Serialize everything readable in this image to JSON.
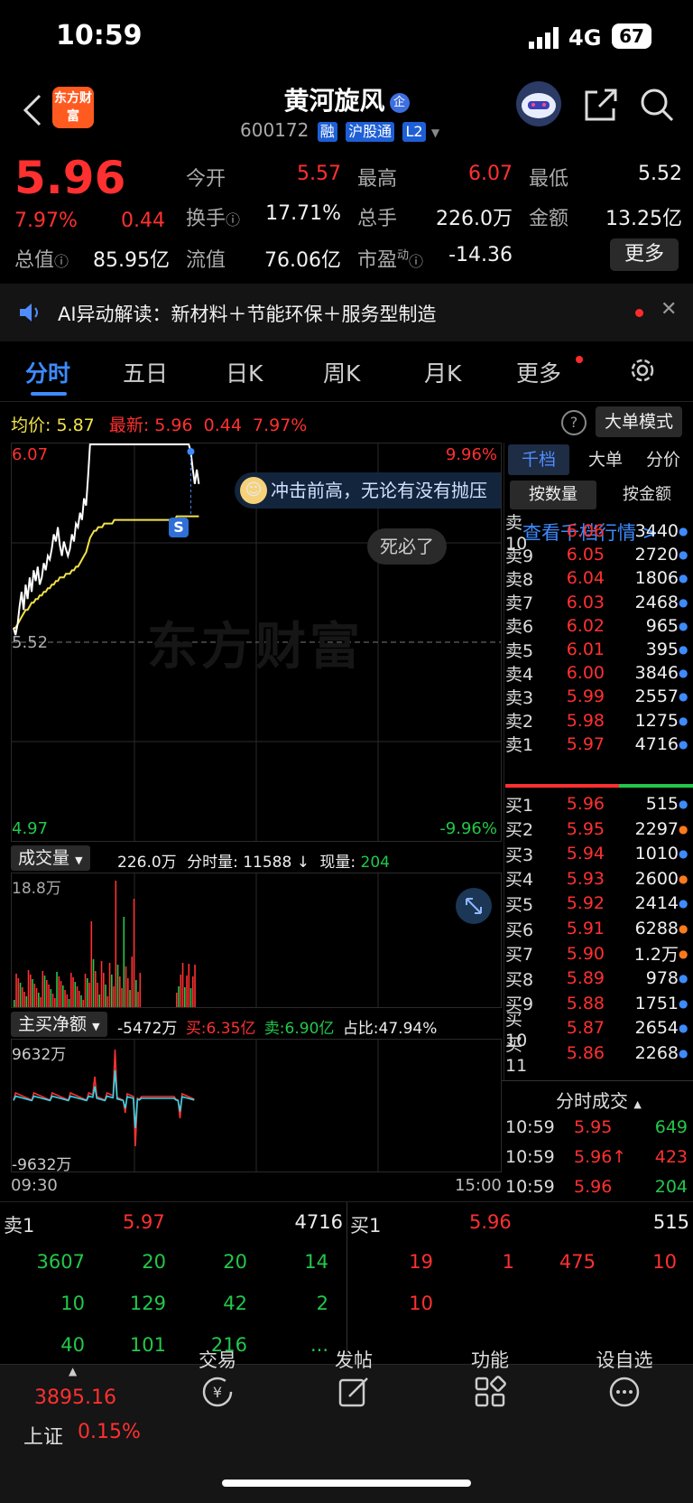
{
  "status_bar": {
    "time": "10:59",
    "network": "4G",
    "battery": "67"
  },
  "header": {
    "title": "黄河旋风",
    "title_badge": "企",
    "code": "600172",
    "tags": [
      "融",
      "沪股通",
      "L2"
    ],
    "logo_text": "东方财富"
  },
  "quote": {
    "price": "5.96",
    "change_pct": "7.97%",
    "change": "0.44",
    "fields": [
      {
        "label": "今开",
        "value": "5.57",
        "color": "#ff3030"
      },
      {
        "label": "最高",
        "value": "6.07",
        "color": "#ff3030"
      },
      {
        "label": "最低",
        "value": "5.52",
        "color": "#f2f2f2"
      },
      {
        "label": "换手",
        "value": "17.71%",
        "color": "#f2f2f2"
      },
      {
        "label": "总手",
        "value": "226.0万",
        "color": "#f2f2f2"
      },
      {
        "label": "金额",
        "value": "13.25亿",
        "color": "#f2f2f2"
      },
      {
        "label": "总值",
        "value": "85.95亿",
        "color": "#f2f2f2"
      },
      {
        "label": "流值",
        "value": "76.06亿",
        "color": "#f2f2f2"
      },
      {
        "label": "市盈",
        "value": "-14.36",
        "color": "#f2f2f2"
      }
    ],
    "pe_sup": "动",
    "more_label": "更多"
  },
  "ai_banner": {
    "text": "AI异动解读：新材料＋节能环保＋服务型制造"
  },
  "tabs": [
    "分时",
    "五日",
    "日K",
    "周K",
    "月K",
    "更多"
  ],
  "chart_header": {
    "avg_label": "均价:",
    "avg_value": "5.87",
    "latest_label": "最新:",
    "latest_value": "5.96",
    "latest_change": "0.44",
    "latest_pct": "7.97%",
    "mode_label": "大单模式"
  },
  "chart_data": {
    "type": "line",
    "y_top": "6.07",
    "y_mid": "5.52",
    "y_bottom": "4.97",
    "pct_top": "9.96%",
    "pct_bottom": "-9.96%",
    "x_start": "09:30",
    "x_end": "15:00",
    "ylim": [
      4.97,
      6.07
    ],
    "price": [
      5.56,
      5.54,
      5.57,
      5.62,
      5.66,
      5.61,
      5.68,
      5.64,
      5.7,
      5.66,
      5.72,
      5.69,
      5.73,
      5.68,
      5.7,
      5.74,
      5.72,
      5.76,
      5.75,
      5.78,
      5.82,
      5.8,
      5.84,
      5.79,
      5.76,
      5.8,
      5.78,
      5.76,
      5.78,
      5.82,
      5.8,
      5.85,
      5.84,
      5.88,
      5.86,
      5.92,
      5.9,
      5.98,
      6.07,
      6.07,
      6.07,
      6.07,
      6.07,
      6.07,
      6.07,
      6.07,
      6.07,
      6.07,
      6.07,
      6.07,
      6.07,
      6.07,
      6.07,
      6.07,
      6.07,
      6.07,
      6.07,
      6.07,
      6.07,
      6.07,
      6.07,
      6.07,
      6.07,
      6.07,
      6.07,
      6.07,
      6.07,
      6.07,
      6.07,
      6.07,
      6.07,
      6.07,
      6.07,
      6.07,
      6.07,
      6.07,
      6.07,
      6.07,
      6.07,
      6.07,
      6.07,
      6.07,
      6.07,
      6.07,
      6.07,
      6.07,
      6.07,
      6.07,
      6.05,
      6.0,
      5.96,
      6.0,
      5.96
    ],
    "avg": [
      5.56,
      5.56,
      5.57,
      5.58,
      5.59,
      5.6,
      5.61,
      5.61,
      5.62,
      5.63,
      5.63,
      5.64,
      5.64,
      5.65,
      5.65,
      5.66,
      5.66,
      5.67,
      5.67,
      5.68,
      5.68,
      5.69,
      5.69,
      5.7,
      5.7,
      5.7,
      5.71,
      5.71,
      5.71,
      5.72,
      5.72,
      5.73,
      5.73,
      5.74,
      5.75,
      5.76,
      5.77,
      5.79,
      5.81,
      5.82,
      5.83,
      5.83,
      5.84,
      5.84,
      5.84,
      5.85,
      5.85,
      5.85,
      5.85,
      5.85,
      5.86,
      5.86,
      5.86,
      5.86,
      5.86,
      5.86,
      5.86,
      5.86,
      5.86,
      5.86,
      5.86,
      5.86,
      5.86,
      5.86,
      5.86,
      5.86,
      5.86,
      5.86,
      5.86,
      5.86,
      5.86,
      5.86,
      5.86,
      5.86,
      5.86,
      5.86,
      5.86,
      5.86,
      5.86,
      5.86,
      5.86,
      5.87,
      5.87,
      5.87,
      5.87,
      5.87,
      5.87,
      5.87,
      5.87,
      5.87,
      5.87,
      5.87,
      5.87
    ]
  },
  "chart_tooltip": {
    "text": "冲击前高，无论有没有抛压",
    "comment": "死必了",
    "marker": "S",
    "watermark": "东方财富"
  },
  "volume": {
    "title": "成交量",
    "total": "226.0万",
    "period_label": "分时量:",
    "period_value": "11588",
    "arrow": "↓",
    "now_label": "现量:",
    "now_value": "204",
    "ymax": "18.8万"
  },
  "net_buy": {
    "title": "主买净额",
    "value": "-5472万",
    "buy_label": "买:",
    "buy_value": "6.35亿",
    "sell_label": "卖:",
    "sell_value": "6.90亿",
    "ratio_label": "占比:",
    "ratio_value": "47.94%",
    "ymax": "9632万",
    "ymin": "-9632万"
  },
  "order_book": {
    "tabs": [
      "千档",
      "大单",
      "分价"
    ],
    "subtabs": [
      "按数量",
      "按金额"
    ],
    "link": "查看千档行情 >",
    "asks": [
      {
        "label": "卖10",
        "price": "6.06",
        "qty": "3440"
      },
      {
        "label": "卖9",
        "price": "6.05",
        "qty": "2720"
      },
      {
        "label": "卖8",
        "price": "6.04",
        "qty": "1806"
      },
      {
        "label": "卖7",
        "price": "6.03",
        "qty": "2468"
      },
      {
        "label": "卖6",
        "price": "6.02",
        "qty": "965"
      },
      {
        "label": "卖5",
        "price": "6.01",
        "qty": "395"
      },
      {
        "label": "卖4",
        "price": "6.00",
        "qty": "3846"
      },
      {
        "label": "卖3",
        "price": "5.99",
        "qty": "2557"
      },
      {
        "label": "卖2",
        "price": "5.98",
        "qty": "1275"
      },
      {
        "label": "卖1",
        "price": "5.97",
        "qty": "4716"
      }
    ],
    "bids": [
      {
        "label": "买1",
        "price": "5.96",
        "qty": "515"
      },
      {
        "label": "买2",
        "price": "5.95",
        "qty": "2297"
      },
      {
        "label": "买3",
        "price": "5.94",
        "qty": "1010"
      },
      {
        "label": "买4",
        "price": "5.93",
        "qty": "2600"
      },
      {
        "label": "买5",
        "price": "5.92",
        "qty": "2414"
      },
      {
        "label": "买6",
        "price": "5.91",
        "qty": "6288"
      },
      {
        "label": "买7",
        "price": "5.90",
        "qty": "1.2万"
      },
      {
        "label": "买8",
        "price": "5.89",
        "qty": "978"
      },
      {
        "label": "买9",
        "price": "5.88",
        "qty": "1751"
      },
      {
        "label": "买10",
        "price": "5.87",
        "qty": "2654"
      },
      {
        "label": "买11",
        "price": "5.86",
        "qty": "2268"
      }
    ]
  },
  "trades": {
    "title": "分时成交",
    "rows": [
      {
        "time": "10:59",
        "price": "5.95",
        "qty": "649",
        "qty_color": "#22c84a"
      },
      {
        "time": "10:59",
        "price": "5.96↑",
        "qty": "423",
        "qty_color": "#ff3030"
      },
      {
        "time": "10:59",
        "price": "5.96",
        "qty": "204",
        "qty_color": "#22c84a"
      }
    ]
  },
  "level2": {
    "sell_label": "卖1",
    "sell_price": "5.97",
    "sell_qty": "4716",
    "buy_label": "买1",
    "buy_price": "5.96",
    "buy_qty": "515",
    "sell_queue": [
      "3607",
      "20",
      "20",
      "14",
      "10",
      "129",
      "42",
      "2",
      "40",
      "101",
      "216",
      "..."
    ],
    "buy_queue": [
      "19",
      "1",
      "475",
      "10",
      "10"
    ]
  },
  "bottom_nav": {
    "index_value": "3895.16",
    "index_name": "上证",
    "index_pct": "0.15%",
    "items": [
      "交易",
      "发帖",
      "功能",
      "设自选"
    ]
  }
}
